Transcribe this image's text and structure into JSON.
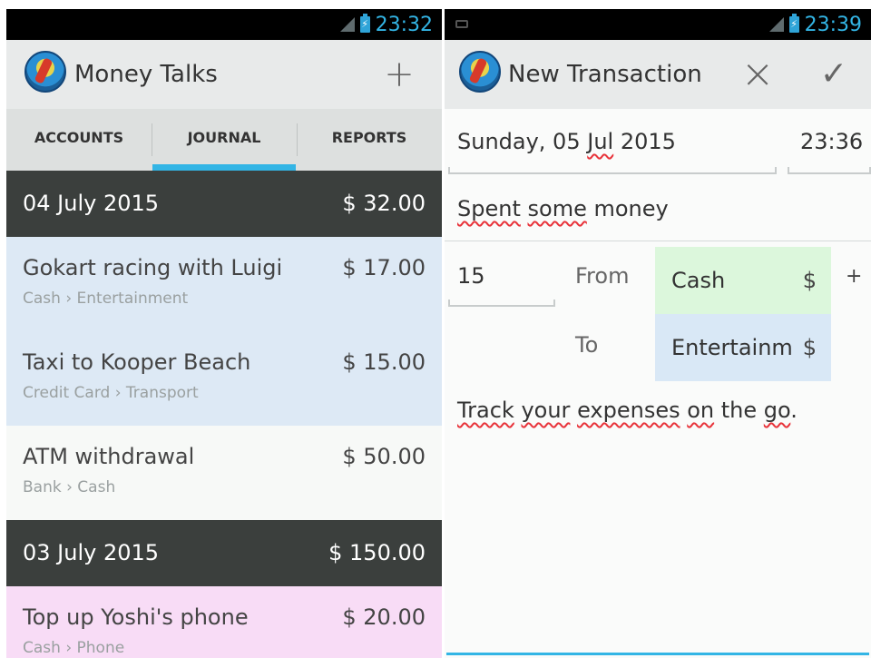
{
  "status": {
    "left_time": "23:32",
    "right_time": "23:39"
  },
  "left": {
    "app_title": "Money Talks",
    "add_icon": "+",
    "tabs": [
      {
        "label": "ACCOUNTS",
        "active": false
      },
      {
        "label": "JOURNAL",
        "active": true
      },
      {
        "label": "REPORTS",
        "active": false
      }
    ],
    "days": [
      {
        "date": "04 July 2015",
        "total": "$ 32.00",
        "entries": [
          {
            "title": "Gokart racing with Luigi",
            "amount": "$ 17.00",
            "accounts": "Cash › Entertainment",
            "color": "#dde9f5"
          },
          {
            "title": "Taxi to Kooper Beach",
            "amount": "$ 15.00",
            "accounts": "Credit Card › Transport",
            "color": "#dde9f5"
          },
          {
            "title": "ATM withdrawal",
            "amount": "$ 50.00",
            "accounts": "Bank › Cash",
            "color": "#f7f9f7"
          }
        ]
      },
      {
        "date": "03 July 2015",
        "total": "$ 150.00",
        "entries": [
          {
            "title": "Top up Yoshi's phone",
            "amount": "$ 20.00",
            "accounts": "Cash › Phone",
            "color": "#f8dcf6"
          }
        ]
      }
    ]
  },
  "right": {
    "title": "New Transaction",
    "close_icon": "×",
    "confirm_icon": "✓",
    "date_pre": "Sunday, 05 ",
    "date_month": "Jul",
    "date_post": " 2015",
    "time": "23:36",
    "description_w1": "Spent",
    "description_w2": "some",
    "description_rest": " money",
    "amount": "15",
    "from_label": "From",
    "from_account": "Cash",
    "from_currency": "$",
    "split_add": "+",
    "to_label": "To",
    "to_account": "Entertainment",
    "to_currency": "$",
    "note_words": [
      {
        "t": "Track",
        "spell": true
      },
      {
        "t": " ",
        "spell": false
      },
      {
        "t": "your",
        "spell": true
      },
      {
        "t": " ",
        "spell": false
      },
      {
        "t": "expenses",
        "spell": true
      },
      {
        "t": " ",
        "spell": false
      },
      {
        "t": "on",
        "spell": true
      },
      {
        "t": " the ",
        "spell": false
      },
      {
        "t": "go",
        "spell": true
      },
      {
        "t": ".",
        "spell": false
      }
    ],
    "colors": {
      "from_bg": "#dcf7dc",
      "to_bg": "#d9e8f6",
      "accent": "#33b5e5"
    }
  }
}
